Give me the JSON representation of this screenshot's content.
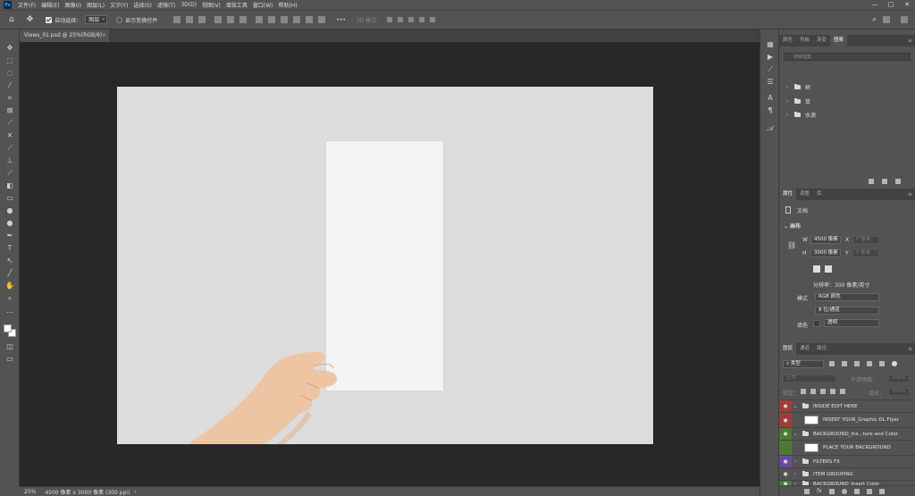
{
  "menu": {
    "logo": "Ps",
    "items": [
      "文件(F)",
      "编辑(E)",
      "图像(I)",
      "图层(L)",
      "文字(Y)",
      "选择(S)",
      "滤镜(T)",
      "3D(D)",
      "视图(V)",
      "增效工具",
      "窗口(W)",
      "帮助(H)"
    ]
  },
  "window_controls": {
    "minimize": "—",
    "maximize": "□",
    "close": "✕"
  },
  "options": {
    "auto_select_label": "自动选择：",
    "auto_select_value": "图层",
    "show_transform_label": "显示变换控件",
    "mode_3d_label": "3D 模式：",
    "more": "•••"
  },
  "document_tab": {
    "title": "Views_01.psd @ 25%(RGB/8)",
    "close": "×"
  },
  "status": {
    "zoom": "25%",
    "size": "4500 像素 x 3000 像素 (300 ppi)",
    "arrow": "›"
  },
  "libraries_panel": {
    "tabs": [
      "颜色",
      "色板",
      "渐变",
      "图案"
    ],
    "active_tab": "图案",
    "search_placeholder": "搜索图案",
    "items": [
      "树",
      "草",
      "水滴"
    ]
  },
  "properties_panel": {
    "tabs": [
      "属性",
      "调整",
      "库"
    ],
    "active_tab": "属性",
    "doc_label": "文档",
    "canvas_label": "画布",
    "w_label": "W",
    "w_value": "4500 像素",
    "x_label": "X",
    "x_value": "0 像素",
    "h_label": "H",
    "h_value": "3000 像素",
    "y_label": "Y",
    "y_value": "0 像素",
    "resolution": "分辨率：300 像素/英寸",
    "mode_label": "模式",
    "mode_value": "RGB 颜色",
    "depth_value": "8 位/通道",
    "fill_label": "填色",
    "fill_value": "透明"
  },
  "layers_panel": {
    "tabs": [
      "图层",
      "通道",
      "路径"
    ],
    "active_tab": "图层",
    "filter_type": "类型",
    "blend_mode": "正常",
    "opacity_label": "不透明度：",
    "opacity_value": "100%",
    "lock_label": "锁定：",
    "fill_label": "填充：",
    "fill_value": "100%",
    "layers": [
      {
        "name": "INSIDE EDIT HERE",
        "type": "folder",
        "color": "red"
      },
      {
        "name": "INSERT YOUR_Graphic DL Flyer",
        "type": "smart",
        "color": "red"
      },
      {
        "name": "BACKGROUND_Ins...ture and Color",
        "type": "folder",
        "color": "green"
      },
      {
        "name": "PLACE YOUR BACKGROUND",
        "type": "smart",
        "color": "green"
      },
      {
        "name": "FILTERS  FX",
        "type": "folder",
        "color": "purple"
      },
      {
        "name": "ITEM GROUPING",
        "type": "folder",
        "color": "none"
      },
      {
        "name": "BACKGROUND_Insert Color",
        "type": "folder",
        "color": "green"
      }
    ]
  }
}
